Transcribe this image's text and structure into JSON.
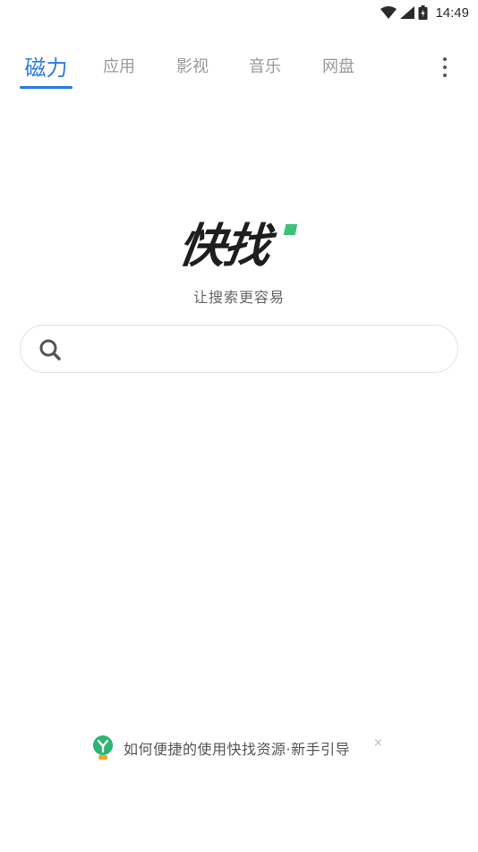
{
  "status_bar": {
    "time": "14:49",
    "icons": [
      "wifi-icon",
      "signal-icon",
      "battery-icon"
    ]
  },
  "tabs": [
    {
      "label": "磁力",
      "active": true
    },
    {
      "label": "应用",
      "active": false
    },
    {
      "label": "影视",
      "active": false
    },
    {
      "label": "音乐",
      "active": false
    },
    {
      "label": "网盘",
      "active": false
    }
  ],
  "colors": {
    "accent": "#2d7be0",
    "logo_accent": "#3cc37a",
    "tab_inactive": "#999999"
  },
  "logo": {
    "text": "快找",
    "slogan": "让搜索更容易"
  },
  "search": {
    "placeholder": "",
    "value": ""
  },
  "guide": {
    "text": "如何便捷的使用快找资源·新手引导",
    "close": "×"
  }
}
